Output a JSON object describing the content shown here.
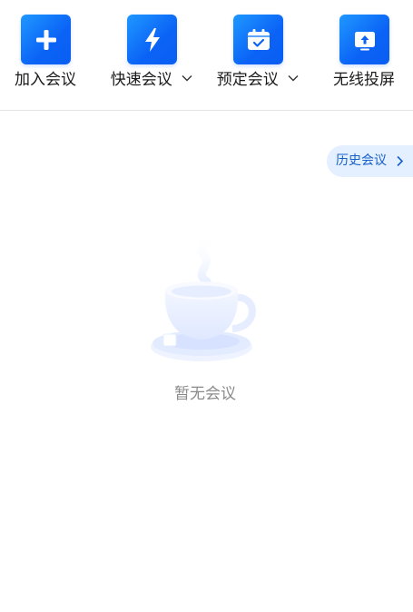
{
  "toolbar": {
    "actions": [
      {
        "label": "加入会议",
        "icon": "plus-icon",
        "has_dropdown": false
      },
      {
        "label": "快速会议",
        "icon": "lightning-icon",
        "has_dropdown": true
      },
      {
        "label": "预定会议",
        "icon": "calendar-check-icon",
        "has_dropdown": true
      },
      {
        "label": "无线投屏",
        "icon": "screen-cast-icon",
        "has_dropdown": false
      }
    ]
  },
  "history": {
    "label": "历史会议",
    "icon": "chevron-right-icon"
  },
  "empty_state": {
    "text": "暂无会议",
    "illustration": "coffee-cup-illustration"
  },
  "colors": {
    "accent": "#0b63f6",
    "history_bg": "#e4efff",
    "history_text": "#1660c8",
    "muted_text": "#8a8a8a",
    "divider": "#e3e3e3"
  }
}
